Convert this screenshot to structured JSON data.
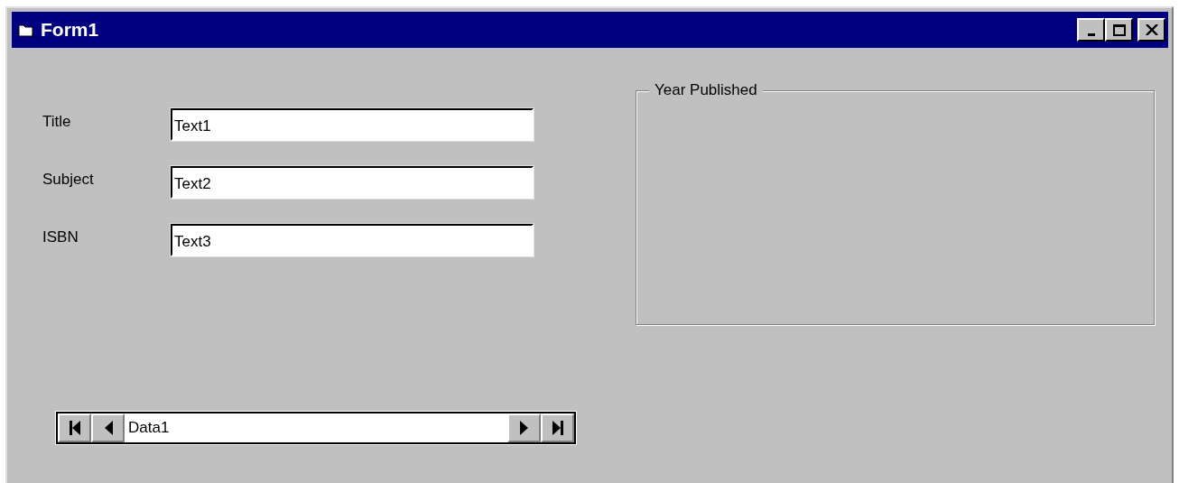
{
  "window": {
    "title": "Form1"
  },
  "fields": [
    {
      "label": "Title",
      "value": "Text1"
    },
    {
      "label": "Subject",
      "value": "Text2"
    },
    {
      "label": "ISBN",
      "value": "Text3"
    }
  ],
  "frame": {
    "caption": "Year Published"
  },
  "data_control": {
    "caption": "Data1"
  }
}
